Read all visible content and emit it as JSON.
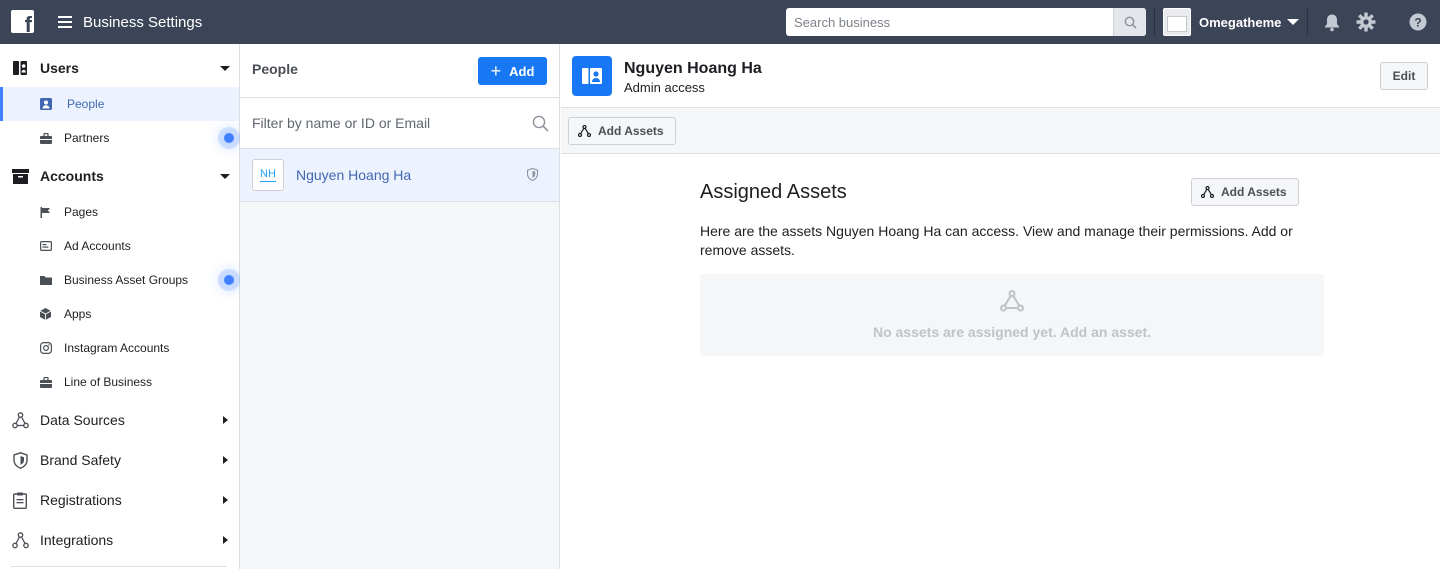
{
  "topbar": {
    "title": "Business Settings",
    "search_placeholder": "Search business",
    "account_name": "Omegatheme",
    "icons": [
      "facebook-logo",
      "menu-icon",
      "search-icon",
      "bell-icon",
      "gear-icon",
      "help-icon"
    ]
  },
  "sidebar": {
    "users": {
      "label": "Users",
      "items": [
        {
          "label": "People",
          "active": true
        },
        {
          "label": "Partners"
        }
      ]
    },
    "accounts": {
      "label": "Accounts",
      "items": [
        {
          "label": "Pages"
        },
        {
          "label": "Ad Accounts"
        },
        {
          "label": "Business Asset Groups"
        },
        {
          "label": "Apps"
        },
        {
          "label": "Instagram Accounts"
        },
        {
          "label": "Line of Business"
        }
      ]
    },
    "sections": [
      {
        "label": "Data Sources"
      },
      {
        "label": "Brand Safety"
      },
      {
        "label": "Registrations"
      },
      {
        "label": "Integrations"
      }
    ]
  },
  "people": {
    "title": "People",
    "add_label": "Add",
    "filter_placeholder": "Filter by name or ID or Email",
    "list": [
      {
        "initials": "NH",
        "name": "Nguyen Hoang Ha"
      }
    ]
  },
  "detail": {
    "name": "Nguyen Hoang Ha",
    "role": "Admin access",
    "edit_label": "Edit",
    "toolbar_add_assets": "Add Assets",
    "assigned_title": "Assigned Assets",
    "assigned_add_assets": "Add Assets",
    "assigned_description": "Here are the assets Nguyen Hoang Ha can access. View and manage their permissions. Add or remove assets.",
    "empty_text": "No assets are assigned yet. Add an asset."
  },
  "colors": {
    "topbar_bg": "#3b4557",
    "accent": "#1877f2",
    "active_bg": "#ecf3ff",
    "active_text": "#4267b2"
  }
}
